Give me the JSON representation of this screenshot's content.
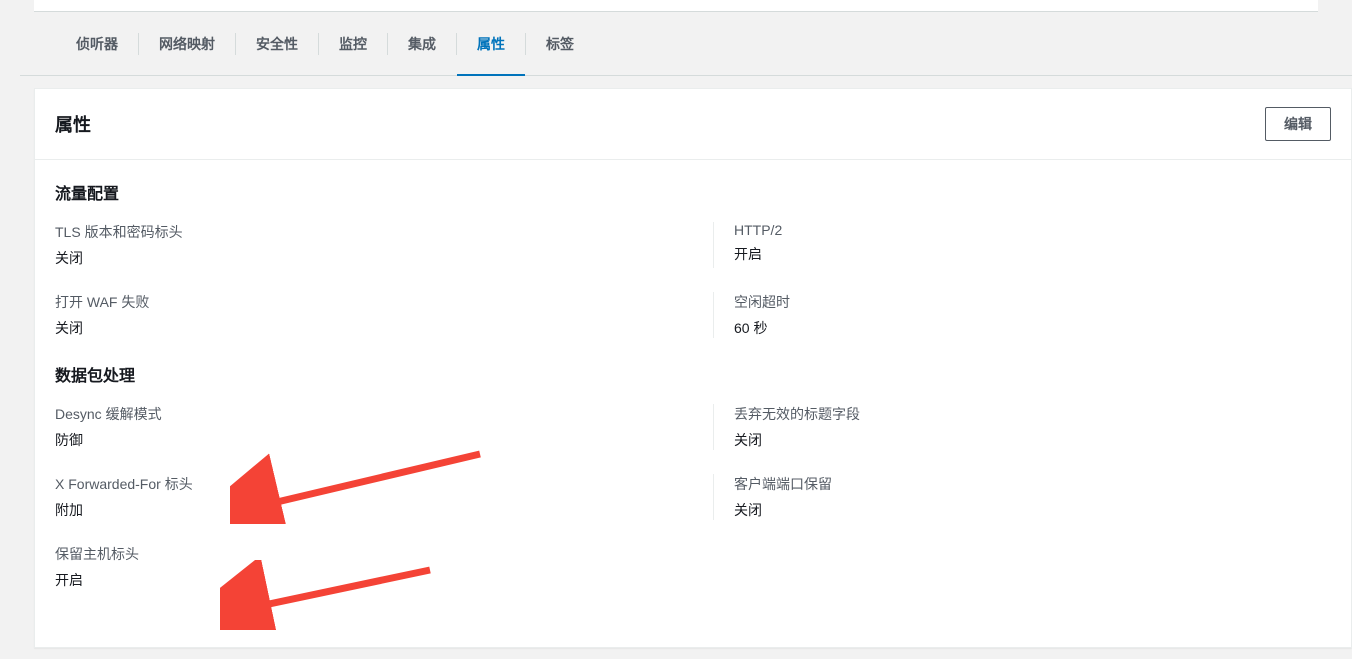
{
  "tabs": {
    "items": [
      {
        "label": "侦听器"
      },
      {
        "label": "网络映射"
      },
      {
        "label": "安全性"
      },
      {
        "label": "监控"
      },
      {
        "label": "集成"
      },
      {
        "label": "属性"
      },
      {
        "label": "标签"
      }
    ],
    "active_index": 5
  },
  "panel": {
    "title": "属性",
    "edit_label": "编辑"
  },
  "sections": {
    "traffic": {
      "title": "流量配置",
      "rows": [
        {
          "left": {
            "label": "TLS 版本和密码标头",
            "value": "关闭"
          },
          "right": {
            "label": "HTTP/2",
            "value": "开启"
          }
        },
        {
          "left": {
            "label": "打开 WAF 失败",
            "value": "关闭"
          },
          "right": {
            "label": "空闲超时",
            "value": "60 秒"
          }
        }
      ]
    },
    "packet": {
      "title": "数据包处理",
      "rows": [
        {
          "left": {
            "label": "Desync 缓解模式",
            "value": "防御"
          },
          "right": {
            "label": "丢弃无效的标题字段",
            "value": "关闭"
          }
        },
        {
          "left": {
            "label": "X Forwarded-For 标头",
            "value": "附加"
          },
          "right": {
            "label": "客户端端口保留",
            "value": "关闭"
          }
        },
        {
          "left": {
            "label": "保留主机标头",
            "value": "开启"
          },
          "right": null
        }
      ]
    }
  }
}
